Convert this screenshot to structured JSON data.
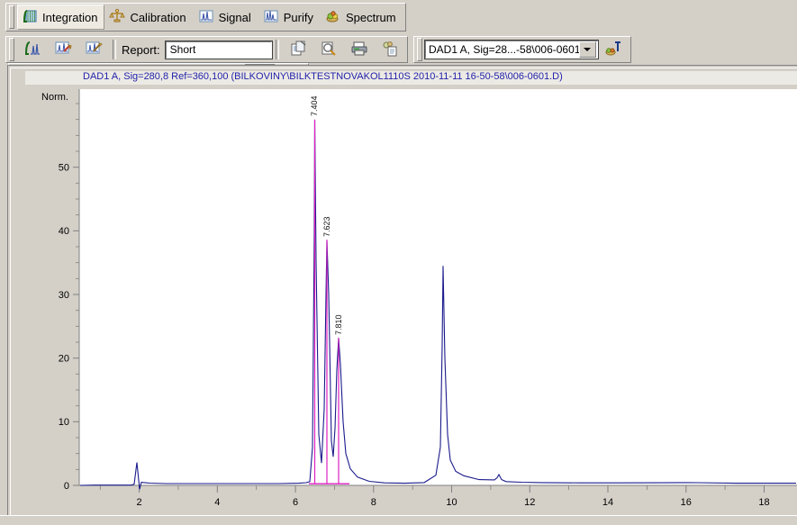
{
  "toolbar_top": {
    "tabs": [
      {
        "label": "Integration",
        "icon": "integration-icon",
        "active": true
      },
      {
        "label": "Calibration",
        "icon": "calibration-scale-icon",
        "active": false
      },
      {
        "label": "Signal",
        "icon": "signal-chart-icon",
        "active": false
      },
      {
        "label": "Purify",
        "icon": "purify-peaks-icon",
        "active": false
      },
      {
        "label": "Spectrum",
        "icon": "spectrum-icon",
        "active": false
      }
    ]
  },
  "toolbar_second": {
    "integrate_icon": "integrate-signal-icon",
    "autointegrate_icon": "auto-integrate-icon",
    "edit_integration_icon": "edit-integration-events-icon",
    "report_label": "Report:",
    "report_value": "Short",
    "report_placeholder": "Short",
    "copy_report_icon": "copy-report-icon",
    "preview_report_icon": "print-preview-icon",
    "print_icon": "printer-icon",
    "report_layout_icon": "report-layout-icon",
    "signal_select_value": "DAD1 A, Sig=28...-58\\006-0601.D)",
    "signal_options": [
      "DAD1 A, Sig=28...-58\\006-0601.D)"
    ],
    "annotate_icon": "annotation-icon",
    "zoom_in_icon": "zoom-in-icon",
    "zoom_out_icon": "zoom-out-icon",
    "select_icon": "arrow-select-icon",
    "baseline_icon": "peak-baseline-icon",
    "valley_icon": "valley-split-icon",
    "tangent_icon": "tangent-skim-icon",
    "multi_peak_icon": "multi-peak-icon",
    "delete_peak_icon": "delete-peak-icon",
    "undo_icon": "undo-integration-icon"
  },
  "plot": {
    "title": "DAD1 A, Sig=280,8 Ref=360,100 (BILKOVINY\\BILKTESTNOVAKOL1110S 2010-11-11 16-50-58\\006-0601.D)"
  },
  "chart_data": {
    "type": "line",
    "title": "DAD1 A, Sig=280,8 Ref=360,100 (BILKOVINY\\BILKTESTNOVAKOL1110S 2010-11-11 16-50-58\\006-0601.D)",
    "xlabel": "",
    "ylabel": "Norm.",
    "xlim": [
      0.45,
      18.85
    ],
    "ylim": [
      -2.5,
      60
    ],
    "xticks": [
      2,
      4,
      6,
      8,
      10,
      12,
      14,
      16,
      18
    ],
    "yticks": [
      0,
      10,
      20,
      30,
      40,
      50
    ],
    "minor_tick_step_x": 0.5,
    "minor_tick_step_y": 2.5,
    "grid": false,
    "legend": "none",
    "trace_color": "#1a1a8c",
    "baseline_color": "#e020c0",
    "annotations": [
      {
        "label": "7.404",
        "retention_time": 7.404,
        "height": 57.5,
        "rotated": true
      },
      {
        "label": "7.623",
        "retention_time": 7.623,
        "height": 38.5,
        "rotated": true
      },
      {
        "label": "7.810",
        "retention_time": 7.81,
        "height": 23.0,
        "rotated": true
      }
    ],
    "peaks": [
      {
        "x": 1.8,
        "y": 3.6,
        "width": 0.1,
        "name": "injection-artifact"
      },
      {
        "x": 7.404,
        "y": 57.5,
        "width": 0.035,
        "name": "peak-7-404"
      },
      {
        "x": 7.623,
        "y": 38.6,
        "width": 0.03,
        "name": "peak-7-623"
      },
      {
        "x": 7.81,
        "y": 23.2,
        "width": 0.075,
        "name": "peak-7-810"
      },
      {
        "x": 10.48,
        "y": 34.5,
        "width": 0.055,
        "name": "peak-10-48"
      },
      {
        "x": 11.92,
        "y": 1.7,
        "width": 0.06,
        "name": "peak-11-92"
      }
    ],
    "baseline_segment": {
      "x_start": 7.28,
      "x_end": 8.3,
      "y": 0.25
    },
    "series": [
      {
        "name": "DAD1 A",
        "x": [
          0.5,
          1.0,
          1.5,
          1.7,
          1.76,
          1.8,
          1.86,
          1.92,
          2.0,
          2.2,
          2.6,
          3.0,
          3.5,
          4.0,
          4.5,
          5.0,
          5.5,
          6.0,
          6.5,
          7.0,
          7.2,
          7.3,
          7.36,
          7.4,
          7.404,
          7.42,
          7.46,
          7.52,
          7.58,
          7.61,
          7.623,
          7.64,
          7.68,
          7.72,
          7.76,
          7.79,
          7.81,
          7.84,
          7.9,
          7.98,
          8.1,
          8.3,
          8.6,
          9.0,
          9.5,
          10.0,
          10.3,
          10.42,
          10.46,
          10.48,
          10.52,
          10.58,
          10.66,
          10.8,
          11.0,
          11.4,
          11.8,
          11.88,
          11.92,
          11.98,
          12.1,
          12.5,
          13.0,
          14.0,
          15.0,
          16.0,
          16.6,
          17.0,
          18.0,
          18.8
        ],
        "y": [
          0.0,
          0.05,
          0.05,
          0.05,
          0.2,
          3.6,
          -0.6,
          0.5,
          0.45,
          0.35,
          0.3,
          0.3,
          0.3,
          0.3,
          0.3,
          0.3,
          0.3,
          0.3,
          0.3,
          0.35,
          0.4,
          0.6,
          6.0,
          40.0,
          57.5,
          35.0,
          8.0,
          3.5,
          12.0,
          30.0,
          38.6,
          30.0,
          7.0,
          4.5,
          9.0,
          18.0,
          23.2,
          19.0,
          10.0,
          5.0,
          2.6,
          1.3,
          0.8,
          0.6,
          0.7,
          1.4,
          3.2,
          8.0,
          22.0,
          34.5,
          20.0,
          8.0,
          4.0,
          2.2,
          1.5,
          0.9,
          0.85,
          1.2,
          1.7,
          1.0,
          0.6,
          0.5,
          0.45,
          0.4,
          0.4,
          0.45,
          0.5,
          0.45,
          0.4,
          0.4
        ]
      }
    ]
  }
}
